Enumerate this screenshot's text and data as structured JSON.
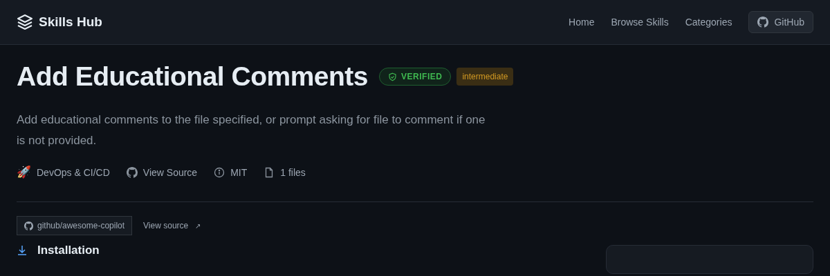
{
  "header": {
    "brand": "Skills Hub",
    "nav": [
      {
        "label": "Home"
      },
      {
        "label": "Browse Skills"
      },
      {
        "label": "Categories"
      }
    ],
    "github_button": "GitHub"
  },
  "skill": {
    "title": "Add Educational Comments",
    "badges": [
      {
        "kind": "verified",
        "label": "VERIFIED"
      },
      {
        "kind": "level",
        "label": "intermediate"
      }
    ],
    "description": "Add educational comments to the file specified, or prompt asking for file to comment if one is not provided.",
    "meta": [
      {
        "kind": "category",
        "label": "DevOps & CI/CD",
        "emoji": "🚀"
      },
      {
        "kind": "source",
        "label": "View Source"
      },
      {
        "kind": "license",
        "label": "MIT"
      },
      {
        "kind": "files",
        "label": "1 files"
      }
    ],
    "repo": "github/awesome-copilot",
    "view_source": "View source",
    "view_source_arrow": "↗"
  },
  "installation": {
    "heading": "Installation"
  }
}
